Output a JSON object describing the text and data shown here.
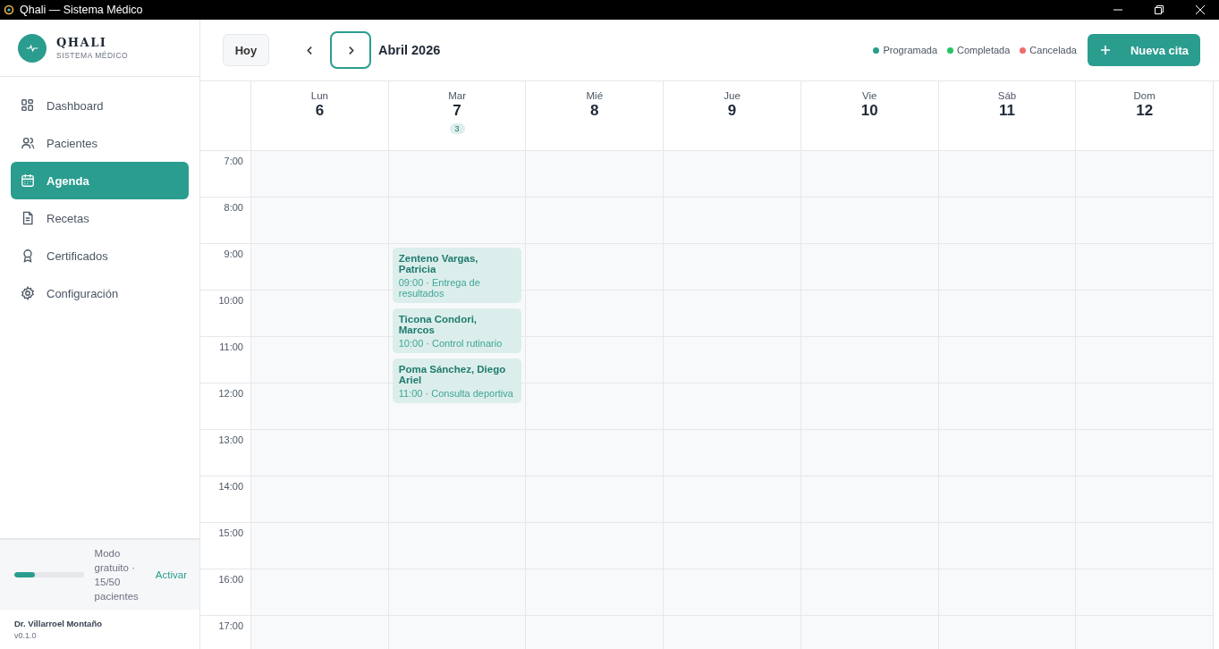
{
  "window": {
    "title": "Qhali — Sistema Médico"
  },
  "brand": {
    "name": "QHALI",
    "subtitle": "SISTEMA MÉDICO"
  },
  "nav": [
    {
      "label": "Dashboard",
      "selected": false
    },
    {
      "label": "Pacientes",
      "selected": false
    },
    {
      "label": "Agenda",
      "selected": true
    },
    {
      "label": "Recetas",
      "selected": false
    },
    {
      "label": "Certificados",
      "selected": false
    },
    {
      "label": "Configuración",
      "selected": false
    }
  ],
  "plan": {
    "level": 0.3,
    "text": "Modo gratuito · 15/50 pacientes",
    "action": "Activar"
  },
  "user": {
    "name": "Dr. Villarroel Montaño",
    "version": "v0.1.0"
  },
  "toolbar": {
    "today": "Hoy",
    "period": "Abril 2026",
    "new_button": "Nueva cita"
  },
  "legend": [
    {
      "label": "Programada",
      "color": "#2a9d8f"
    },
    {
      "label": "Completada",
      "color": "#22c55e"
    },
    {
      "label": "Cancelada",
      "color": "#f06c6c"
    }
  ],
  "days": [
    {
      "weekday": "Lun",
      "date": "6"
    },
    {
      "weekday": "Mar",
      "date": "7",
      "count": "3",
      "events": [
        {
          "patient": "Zenteno Vargas, Patricia",
          "detail": "09:00 · Entrega de resultados"
        },
        {
          "patient": "Ticona Condori, Marcos",
          "detail": "10:00 · Control rutinario"
        },
        {
          "patient": "Poma Sánchez, Diego Ariel",
          "detail": "11:00 · Consulta deportiva"
        }
      ]
    },
    {
      "weekday": "Mié",
      "date": "8"
    },
    {
      "weekday": "Jue",
      "date": "9"
    },
    {
      "weekday": "Vie",
      "date": "10"
    },
    {
      "weekday": "Sáb",
      "date": "11"
    },
    {
      "weekday": "Dom",
      "date": "12"
    }
  ],
  "hours": [
    "7:00",
    "8:00",
    "9:00",
    "10:00",
    "11:00",
    "12:00",
    "13:00",
    "14:00",
    "15:00",
    "16:00",
    "17:00"
  ]
}
